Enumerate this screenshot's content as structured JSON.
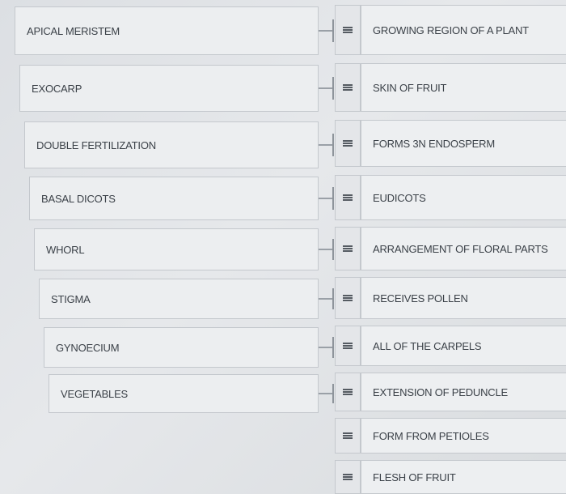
{
  "terms": [
    {
      "label": "APICAL MERISTEM"
    },
    {
      "label": "EXOCARP"
    },
    {
      "label": "DOUBLE FERTILIZATION"
    },
    {
      "label": "BASAL DICOTS"
    },
    {
      "label": "WHORL"
    },
    {
      "label": "STIGMA"
    },
    {
      "label": "GYNOECIUM"
    },
    {
      "label": "VEGETABLES"
    }
  ],
  "answers": [
    {
      "label": "GROWING REGION OF A PLANT"
    },
    {
      "label": "SKIN OF FRUIT"
    },
    {
      "label": "FORMS 3N ENDOSPERM"
    },
    {
      "label": "EUDICOTS"
    },
    {
      "label": "ARRANGEMENT OF FLORAL PARTS"
    },
    {
      "label": "RECEIVES POLLEN"
    },
    {
      "label": "ALL OF THE CARPELS"
    },
    {
      "label": "EXTENSION OF PEDUNCLE"
    },
    {
      "label": "FORM FROM PETIOLES"
    },
    {
      "label": "FLESH OF FRUIT"
    }
  ],
  "icons": {
    "drag_handle": "drag-handle-icon"
  }
}
